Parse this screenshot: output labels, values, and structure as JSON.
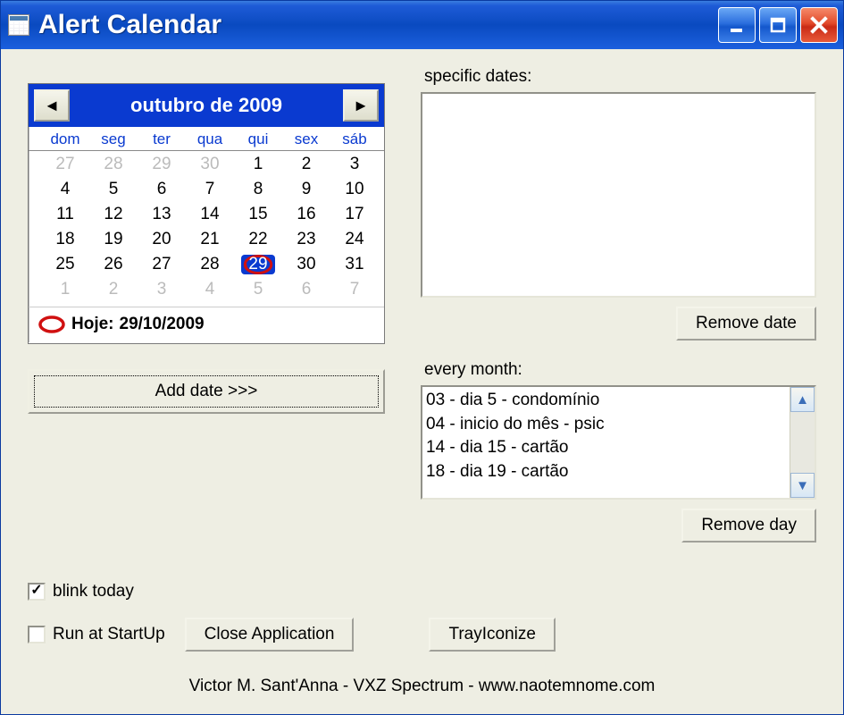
{
  "window": {
    "title": "Alert Calendar"
  },
  "calendar": {
    "month_label": "outubro de 2009",
    "dow": [
      "dom",
      "seg",
      "ter",
      "qua",
      "qui",
      "sex",
      "sáb"
    ],
    "cells": [
      {
        "d": "27",
        "fade": true
      },
      {
        "d": "28",
        "fade": true
      },
      {
        "d": "29",
        "fade": true
      },
      {
        "d": "30",
        "fade": true
      },
      {
        "d": "1"
      },
      {
        "d": "2"
      },
      {
        "d": "3"
      },
      {
        "d": "4"
      },
      {
        "d": "5"
      },
      {
        "d": "6"
      },
      {
        "d": "7"
      },
      {
        "d": "8"
      },
      {
        "d": "9"
      },
      {
        "d": "10"
      },
      {
        "d": "11"
      },
      {
        "d": "12"
      },
      {
        "d": "13"
      },
      {
        "d": "14"
      },
      {
        "d": "15"
      },
      {
        "d": "16"
      },
      {
        "d": "17"
      },
      {
        "d": "18"
      },
      {
        "d": "19"
      },
      {
        "d": "20"
      },
      {
        "d": "21"
      },
      {
        "d": "22"
      },
      {
        "d": "23"
      },
      {
        "d": "24"
      },
      {
        "d": "25"
      },
      {
        "d": "26"
      },
      {
        "d": "27"
      },
      {
        "d": "28"
      },
      {
        "d": "29",
        "today": true
      },
      {
        "d": "30"
      },
      {
        "d": "31"
      },
      {
        "d": "1",
        "fade": true
      },
      {
        "d": "2",
        "fade": true
      },
      {
        "d": "3",
        "fade": true
      },
      {
        "d": "4",
        "fade": true
      },
      {
        "d": "5",
        "fade": true
      },
      {
        "d": "6",
        "fade": true
      },
      {
        "d": "7",
        "fade": true
      }
    ],
    "today_prefix": "Hoje: ",
    "today_date": "29/10/2009"
  },
  "buttons": {
    "add_date": "Add date >>>",
    "remove_date": "Remove date",
    "remove_day": "Remove day",
    "close_app": "Close Application",
    "tray": "TrayIconize"
  },
  "labels": {
    "specific": "specific dates:",
    "every_month": "every month:",
    "blink_today": "blink today",
    "run_startup": "Run at StartUp"
  },
  "checks": {
    "blink_today": true,
    "run_startup": false
  },
  "lists": {
    "specific": [],
    "monthly": [
      "03 - dia 5 - condomínio",
      "04 - inicio do mês -  psic",
      "14 - dia 15 - cartão",
      "18 - dia 19 - cartão"
    ]
  },
  "credits": "Victor M. Sant'Anna - VXZ Spectrum - www.naotemnome.com"
}
